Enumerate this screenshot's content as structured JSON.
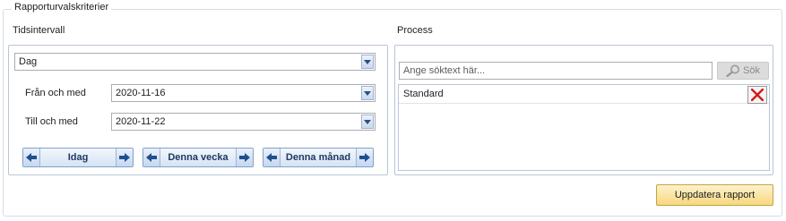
{
  "group": {
    "title": "Rapporturvalskriterier"
  },
  "time": {
    "heading": "Tidsintervall",
    "period": {
      "value": "Dag"
    },
    "from": {
      "label": "Från och med",
      "value": "2020-11-16"
    },
    "to": {
      "label": "Till och med",
      "value": "2020-11-22"
    },
    "nav": [
      {
        "label": "Idag"
      },
      {
        "label": "Denna vecka"
      },
      {
        "label": "Denna månad"
      }
    ]
  },
  "process": {
    "heading": "Process",
    "search": {
      "placeholder": "Ange söktext här...",
      "button_label": "Sök"
    },
    "items": [
      {
        "label": "Standard"
      }
    ]
  },
  "actions": {
    "update_label": "Uppdatera rapport"
  },
  "colors": {
    "accent_border": "#7ea1cf",
    "delete_icon": "#d11a1a",
    "update_button": "#f7d880"
  }
}
